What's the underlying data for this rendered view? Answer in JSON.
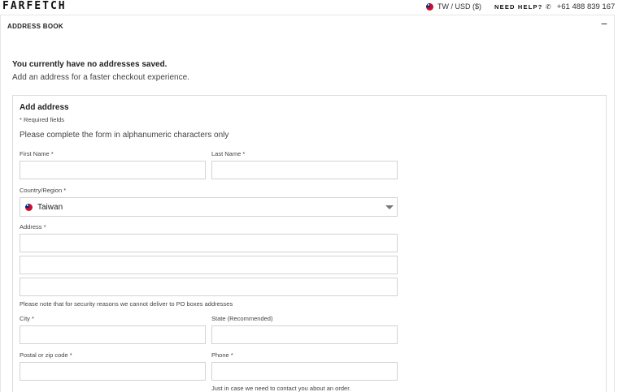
{
  "header": {
    "logo": "FARFETCH",
    "locale": "TW / USD ($)",
    "help": "NEED HELP?",
    "phone": "+61 488 839 167"
  },
  "panel": {
    "title": "ADDRESS BOOK",
    "collapse_symbol": "−"
  },
  "empty": {
    "title": "You currently have no addresses saved.",
    "description": "Add an address for a faster checkout experience."
  },
  "form": {
    "title": "Add address",
    "required_note": "* Required fields",
    "complete_note": "Please complete the form in alphanumeric characters only",
    "first_name_label": "First Name *",
    "last_name_label": "Last Name *",
    "country_label": "Country/Region *",
    "country_value": "Taiwan",
    "address_label": "Address *",
    "po_box_note": "Please note that for security reasons we cannot deliver to PO boxes addresses",
    "city_label": "City *",
    "state_label": "State (Recommended)",
    "postal_label": "Postal or zip code *",
    "phone_label": "Phone *",
    "phone_note": "Just in case we need to contact you about an order."
  },
  "icons": {
    "flag": "taiwan-flag-icon",
    "phone": "phone-icon",
    "caret": "chevron-down-icon"
  }
}
